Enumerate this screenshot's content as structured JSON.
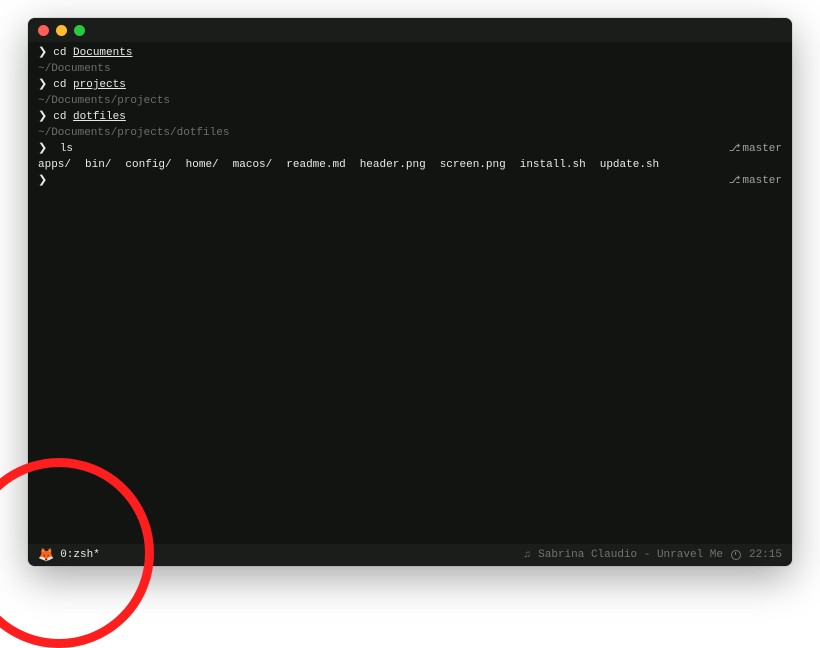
{
  "titlebar": {
    "close": "close",
    "minimize": "minimize",
    "zoom": "zoom"
  },
  "lines": {
    "l0_cmd": "cd",
    "l0_arg": "Documents",
    "l1_path": "~/Documents",
    "l2_cmd": "cd",
    "l2_arg": "projects",
    "l3_path": "~/Documents/projects",
    "l4_cmd": "cd",
    "l4_arg": "dotfiles",
    "l5_path": "~/Documents/projects/dotfiles",
    "l6_cmd": "ls",
    "l6_branch": "master",
    "ls_items": {
      "i0": "apps/",
      "i1": "bin/",
      "i2": "config/",
      "i3": "home/",
      "i4": "macos/",
      "i5": "readme.md",
      "i6": "header.png",
      "i7": "screen.png",
      "i8": "install.sh",
      "i9": "update.sh"
    },
    "l8_branch": "master"
  },
  "caret": "❯",
  "status": {
    "session_icon": "🦊",
    "session": "0:zsh*",
    "music_icon": "♫",
    "now_playing": "Sabrina Claudio - Unravel Me",
    "time": "22:15"
  }
}
